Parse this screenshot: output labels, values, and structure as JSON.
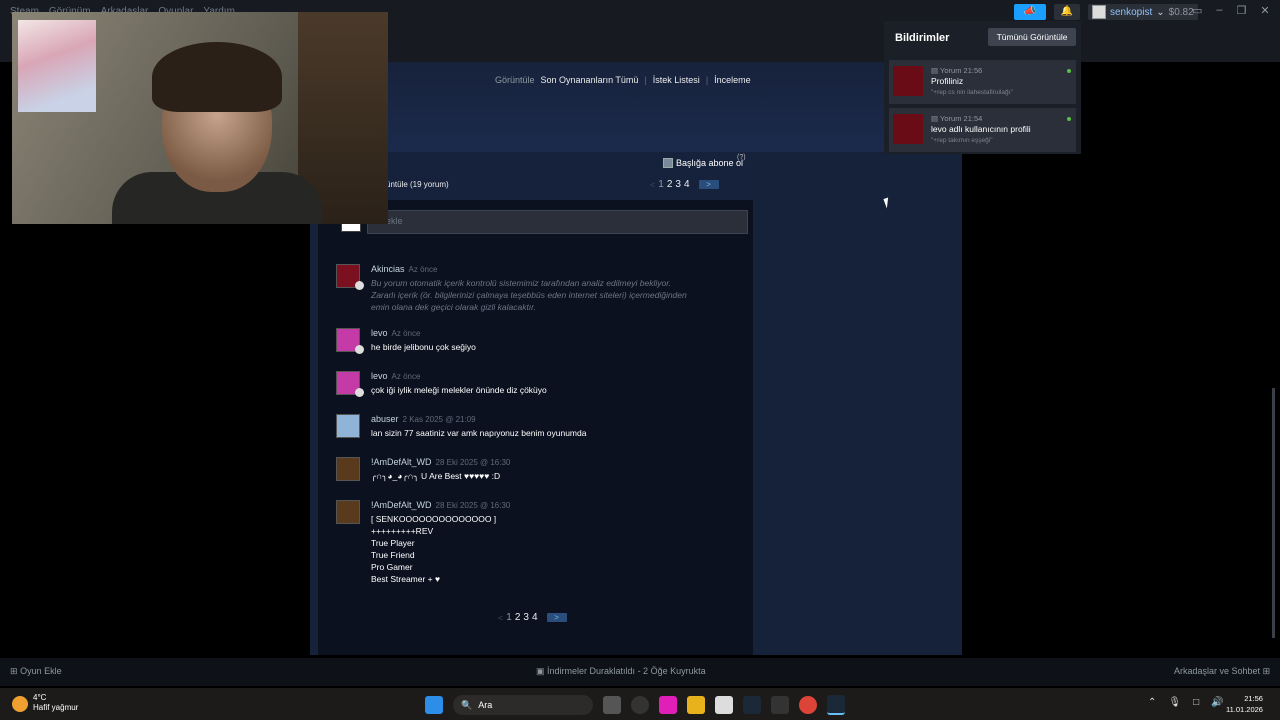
{
  "menu": [
    "Steam",
    "Görünüm",
    "Arkadaşlar",
    "Oyunlar",
    "Yardım"
  ],
  "account": {
    "name": "senkopist",
    "wallet": "$0.82"
  },
  "profile_links": {
    "prefix": "Görüntüle",
    "recent": "Son Oynananların Tümü",
    "wishlist": "İstek Listesi",
    "reviews": "İnceleme"
  },
  "comments": {
    "subscribe_label": "Başlığa abone ol",
    "help_mark": "(?)",
    "view_all": "üntüle (19 yorum)",
    "pages": [
      "1",
      "2",
      "3",
      "4"
    ],
    "prev": "<",
    "next": ">",
    "add_placeholder": "m ekle",
    "items": [
      {
        "author": "Akincias",
        "time": "Az önce",
        "body": [
          "Bu yorum otomatik içerik kontrolü sistemimiz tarafından analiz edilmeyi bekliyor.",
          "Zararlı içerik (ör. bilgilerinizi çalmaya teşebbüs eden internet siteleri) içermediğinden",
          "emin olana dek geçici olarak gizli kalacaktır."
        ]
      },
      {
        "author": "levo",
        "time": "Az önce",
        "body": [
          "he birde jelibonu çok seğiyo"
        ]
      },
      {
        "author": "levo",
        "time": "Az önce",
        "body": [
          "çok iği iylik meleği melekler önünde diz çöküyo"
        ]
      },
      {
        "author": "abuser",
        "time": "2 Kas 2025 @ 21:09",
        "body": [
          "lan sizin 77 saatiniz var amk napıyonuz benim oyunumda"
        ]
      },
      {
        "author": "!AmDefAlt_WD",
        "time": "28 Eki 2025 @ 16:30",
        "body": [
          "╭∩╮◕_◕╭∩╮ U Are Best ♥♥♥♥♥ :D"
        ]
      },
      {
        "author": "!AmDefAlt_WD",
        "time": "28 Eki 2025 @ 16:30",
        "body": [
          "[ SENKOOOOOOOOOOOOOO ]",
          "+++++++++REV",
          "True Player",
          "True Friend",
          "Pro Gamer",
          "Best Streamer + ♥"
        ]
      }
    ]
  },
  "notifications": {
    "title": "Bildirimler",
    "view_all": "Tümünü Görüntüle",
    "items": [
      {
        "type": "Yorum",
        "time": "21:56",
        "title": "Profiliniz",
        "snippet": "\"+rep cs nin ilahestafiruilağı\""
      },
      {
        "type": "Yorum",
        "time": "21:54",
        "title": "levo adlı kullanıcının profili",
        "snippet": "\"+rep takımın eşşeği\""
      }
    ]
  },
  "steam_bottom": {
    "add_game": "Oyun Ekle",
    "downloads": "İndirmeler Duraklatıldı - 2 Öğe Kuyrukta",
    "friends": "Arkadaşlar ve Sohbet"
  },
  "taskbar": {
    "temp": "4°C",
    "condition": "Hafif yağmur",
    "search": "Ara",
    "time": "21:56",
    "date": "11.01.2026"
  },
  "colors": {
    "accent": "#1a9fff",
    "online": "#59bf40",
    "panel": "#1b1f27"
  }
}
